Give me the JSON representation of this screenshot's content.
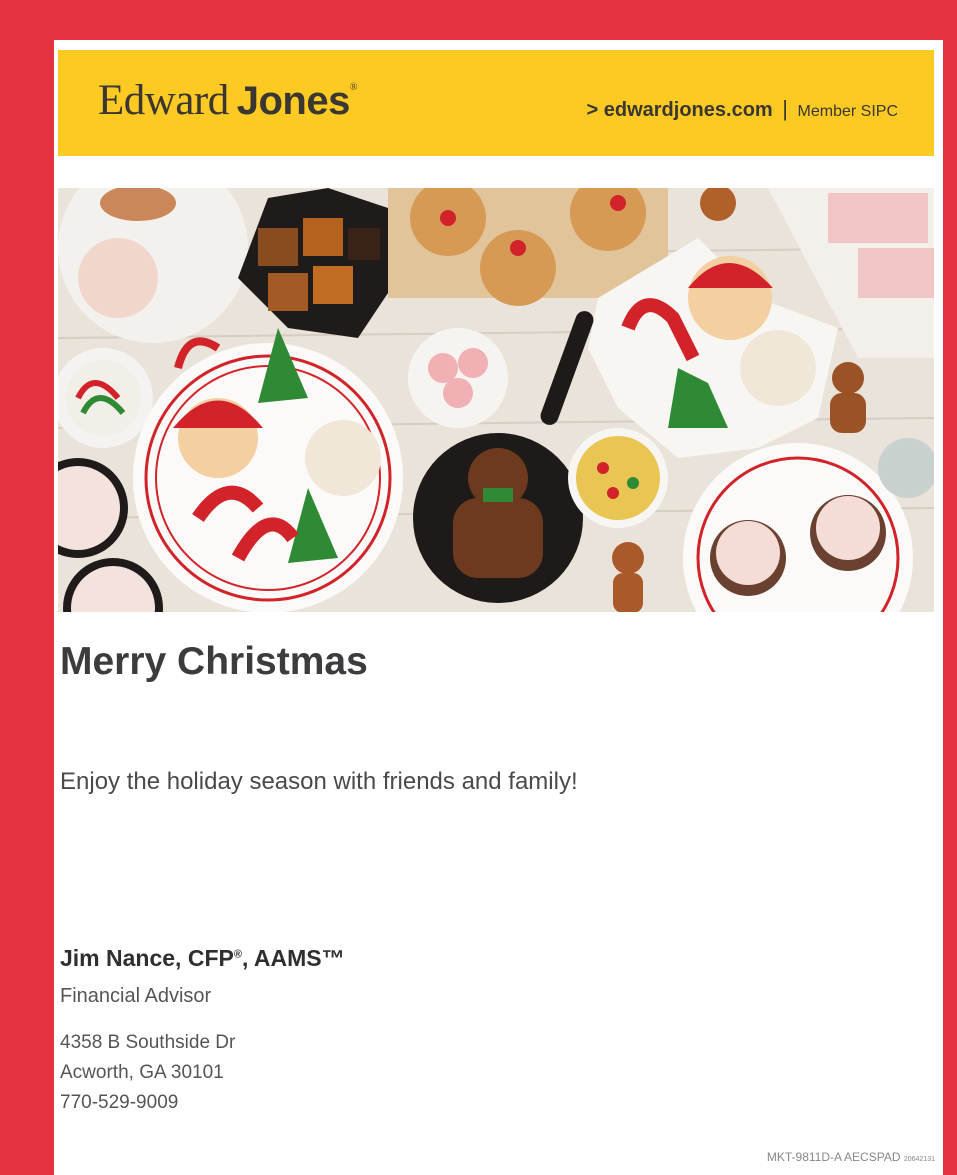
{
  "header": {
    "logo_text_1": "Edward",
    "logo_text_2": "Jones",
    "logo_mark": "®",
    "site_link": "> edwardjones.com",
    "separator": "|",
    "member": "Member SIPC"
  },
  "hero": {
    "icon": "holiday-cookies-photo"
  },
  "content": {
    "headline": "Merry Christmas",
    "greeting": "Enjoy the holiday season with friends and family!"
  },
  "advisor": {
    "name": "Jim Nance, CFP",
    "reg_mark": "®",
    "credentials": ", AAMS™",
    "title": "Financial Advisor",
    "address_line1": "4358 B Southside Dr",
    "address_line2": "Acworth, GA 30101",
    "phone": "770-529-9009"
  },
  "footer": {
    "code": "MKT-9811D-A  AECSPAD",
    "small_code": "20642131"
  },
  "colors": {
    "frame": "#e5333f",
    "banner": "#fcca22",
    "text_dark": "#3c3c3e"
  }
}
